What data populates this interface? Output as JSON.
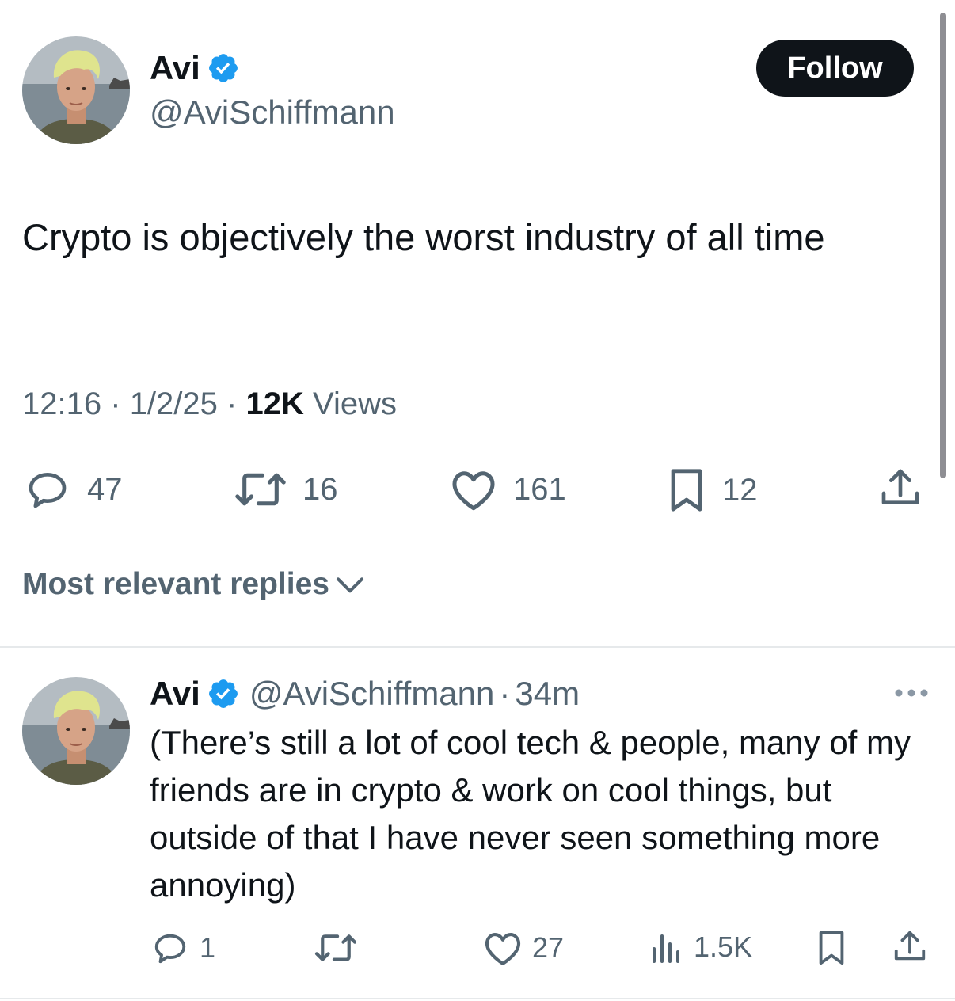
{
  "tweet": {
    "author_name": "Avi",
    "author_handle": "@AviSchiffmann",
    "follow_label": "Follow",
    "text": "Crypto is objectively the worst industry of all time",
    "time": "12:16",
    "separator": "·",
    "date": "1/2/25",
    "views_count": "12K",
    "views_label": "Views",
    "stats": {
      "replies": "47",
      "reposts": "16",
      "likes": "161",
      "bookmarks": "12"
    }
  },
  "replies_sort_label": "Most relevant replies",
  "reply": {
    "author_name": "Avi",
    "author_handle": "@AviSchiffmann",
    "separator": "·",
    "age": "34m",
    "text": "(There’s still a lot of cool tech & people, many of my friends are in crypto & work on cool things, but outside of that I have never seen something more annoying)",
    "stats": {
      "replies": "1",
      "likes": "27",
      "views": "1.5K"
    }
  },
  "colors": {
    "verified": "#1d9bf0",
    "text_primary": "#0f1419",
    "text_secondary": "#536471",
    "follow_bg": "#0f1419"
  },
  "icons": [
    "verified-badge-icon",
    "reply-icon",
    "repost-icon",
    "like-icon",
    "bookmark-icon",
    "share-icon",
    "views-icon",
    "chevron-down-icon",
    "more-icon"
  ]
}
